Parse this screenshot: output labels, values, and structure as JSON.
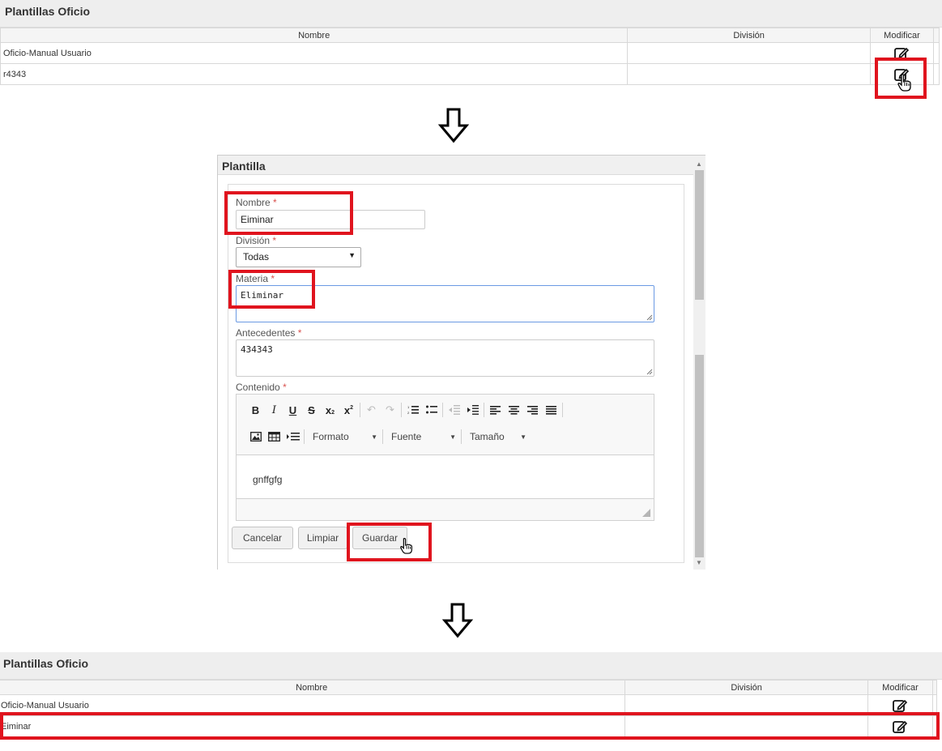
{
  "panel_top": {
    "title": "Plantillas Oficio",
    "columns": [
      "Nombre",
      "División",
      "Modificar"
    ],
    "rows": [
      {
        "nombre": "Oficio-Manual Usuario",
        "division": ""
      },
      {
        "nombre": "r4343",
        "division": ""
      }
    ]
  },
  "form": {
    "title": "Plantilla",
    "nombre_label": "Nombre",
    "nombre_value": "Eiminar",
    "division_label": "División",
    "division_value": "Todas",
    "materia_label": "Materia",
    "materia_value": "Eliminar",
    "antecedentes_label": "Antecedentes",
    "antecedentes_value": "434343",
    "contenido_label": "Contenido",
    "required_mark": "*",
    "toolbar": {
      "formato": "Formato",
      "fuente": "Fuente",
      "tamano": "Tamaño"
    },
    "contenido_value": "gnffgfg",
    "buttons": {
      "cancel": "Cancelar",
      "clear": "Limpiar",
      "save": "Guardar"
    }
  },
  "panel_bottom": {
    "title": "Plantillas Oficio",
    "columns": [
      "Nombre",
      "División",
      "Modificar"
    ],
    "rows": [
      {
        "nombre": "Oficio-Manual Usuario",
        "division": ""
      },
      {
        "nombre": "Eiminar",
        "division": ""
      }
    ]
  },
  "colors": {
    "highlight": "#e0141e",
    "header_bg": "#eeeeee",
    "materia_focus": "#6b9ae3"
  }
}
